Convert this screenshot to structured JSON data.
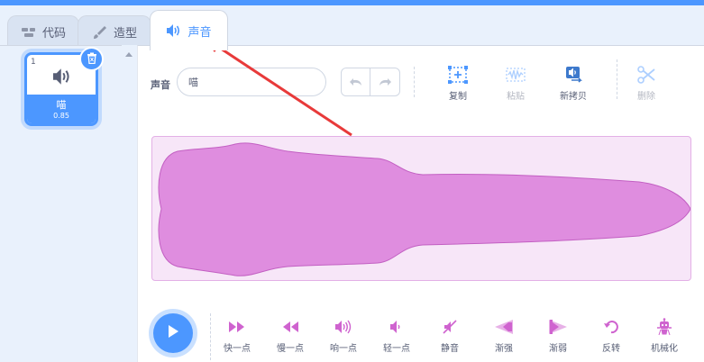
{
  "tabs": [
    {
      "label": "代码",
      "icon": "code-icon"
    },
    {
      "label": "造型",
      "icon": "brush-icon"
    },
    {
      "label": "声音",
      "icon": "speaker-icon"
    }
  ],
  "sound_list": [
    {
      "index": "1",
      "name": "喵",
      "duration": "0.85"
    }
  ],
  "editor": {
    "name_label": "声音",
    "name_value": "喵",
    "tools": [
      {
        "label": "复制",
        "icon": "copy-icon",
        "enabled": true
      },
      {
        "label": "粘贴",
        "icon": "paste-icon",
        "enabled": false
      },
      {
        "label": "新拷贝",
        "icon": "new-copy-icon",
        "enabled": true
      },
      {
        "label": "删除",
        "icon": "scissors-icon",
        "enabled": false
      }
    ],
    "effects": [
      {
        "label": "快一点",
        "icon": "faster-icon"
      },
      {
        "label": "慢一点",
        "icon": "slower-icon"
      },
      {
        "label": "响一点",
        "icon": "louder-icon"
      },
      {
        "label": "轻一点",
        "icon": "softer-icon"
      },
      {
        "label": "静音",
        "icon": "mute-icon"
      },
      {
        "label": "渐强",
        "icon": "fade-in-icon"
      },
      {
        "label": "渐弱",
        "icon": "fade-out-icon"
      },
      {
        "label": "反转",
        "icon": "reverse-icon"
      },
      {
        "label": "机械化",
        "icon": "robot-icon"
      }
    ]
  },
  "colors": {
    "accent": "#4c97ff",
    "wave_fill": "#df8ddf",
    "wave_bg": "#f7e6f8",
    "effect_icon": "#cf63cf",
    "annotation_arrow": "#e83a3a"
  }
}
